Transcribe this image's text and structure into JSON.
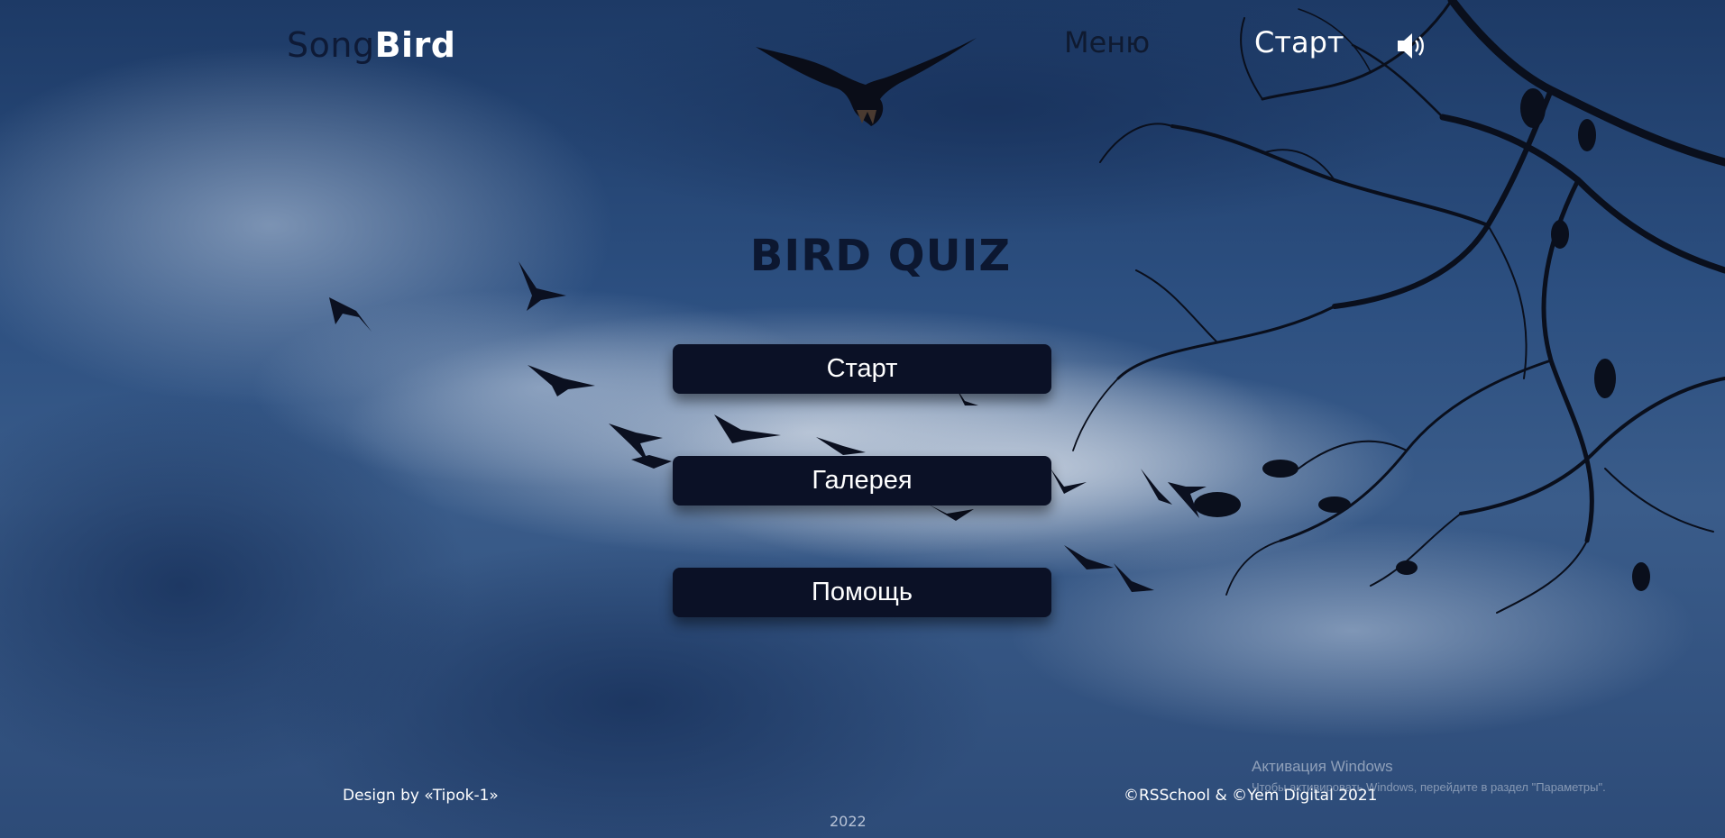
{
  "header": {
    "logo": {
      "song": "Song",
      "bird": "Bird"
    },
    "nav": {
      "menu_label": "Меню",
      "start_label": "Старт"
    },
    "sound_icon": "speaker-volume-icon",
    "bird_icon": "flying-bird-icon"
  },
  "main": {
    "title": "BIRD QUIZ",
    "buttons": [
      {
        "label": "Старт"
      },
      {
        "label": "Галерея"
      },
      {
        "label": "Помощь"
      }
    ]
  },
  "footer": {
    "design": "Design by «Tipok-1»",
    "copyright": "©RSSchool & ©Yem Digital 2021",
    "year": "2022"
  },
  "windows_watermark": {
    "title": "Активация Windows",
    "subtitle": "Чтобы активировать Windows, перейдите в раздел \"Параметры\"."
  },
  "colors": {
    "button_bg": "#0b1126",
    "title": "#0c1730",
    "sky": "#2c4f80"
  }
}
